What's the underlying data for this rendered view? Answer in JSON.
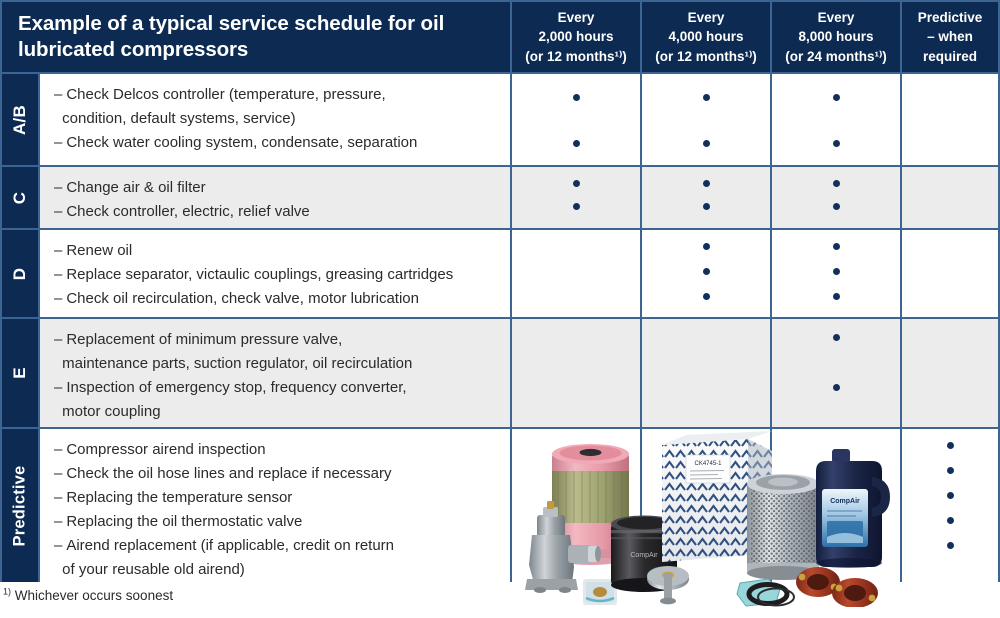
{
  "header": {
    "title": "Example of a typical service schedule for oil lubricated compressors",
    "columns": [
      {
        "id": "every-2000",
        "lines": [
          "Every",
          "2,000 hours",
          "(or 12 months¹⁾)"
        ]
      },
      {
        "id": "every-4000",
        "lines": [
          "Every",
          "4,000 hours",
          "(or 12 months¹⁾)"
        ]
      },
      {
        "id": "every-8000",
        "lines": [
          "Every",
          "8,000 hours",
          "(or 24 months¹⁾)"
        ]
      },
      {
        "id": "predictive",
        "lines": [
          "Predictive",
          "– when",
          "required"
        ]
      }
    ]
  },
  "rows": [
    {
      "id": "ab",
      "label": "A/B",
      "shade": "white",
      "tasks": [
        {
          "text": "Check Delcos controller (temperature, pressure,",
          "cont": "condition, default  systems, service)"
        },
        {
          "text": "Check water cooling system, condensate, separation"
        }
      ],
      "marks": {
        "every-2000": 2,
        "every-4000": 2,
        "every-8000": 2,
        "predictive": 0
      }
    },
    {
      "id": "c",
      "label": "C",
      "shade": "gray",
      "tasks": [
        {
          "text": "Change air & oil filter"
        },
        {
          "text": "Check controller, electric, relief valve"
        }
      ],
      "marks": {
        "every-2000": 2,
        "every-4000": 2,
        "every-8000": 2,
        "predictive": 0
      }
    },
    {
      "id": "d",
      "label": "D",
      "shade": "white",
      "tasks": [
        {
          "text": "Renew oil"
        },
        {
          "text": "Replace separator, victaulic couplings, greasing cartridges"
        },
        {
          "text": "Check oil recirculation, check valve, motor lubrication"
        }
      ],
      "marks": {
        "every-2000": 0,
        "every-4000": 3,
        "every-8000": 3,
        "predictive": 0
      }
    },
    {
      "id": "e",
      "label": "E",
      "shade": "gray",
      "tasks": [
        {
          "text": "Replacement of minimum pressure valve,",
          "cont": "maintenance parts, suction regulator, oil recirculation"
        },
        {
          "text": "Inspection of emergency stop, frequency converter,",
          "cont": "motor coupling"
        }
      ],
      "marks": {
        "every-2000": 0,
        "every-4000": 0,
        "every-8000": 2,
        "predictive": 0
      }
    },
    {
      "id": "predictive",
      "label": "Predictive",
      "shade": "white",
      "tasks": [
        {
          "text": "Compressor airend inspection"
        },
        {
          "text": "Check the oil hose lines and replace if necessary"
        },
        {
          "text": "Replacing the temperature sensor"
        },
        {
          "text": "Replacing the oil thermostatic valve"
        },
        {
          "text": "Airend replacement (if applicable, credit on return",
          "cont": "of your reusable old airend)"
        }
      ],
      "marks": {
        "every-2000": 0,
        "every-4000": 0,
        "every-8000": 0,
        "predictive": 5
      }
    }
  ],
  "footnote": {
    "marker": "1)",
    "text": " Whichever occurs soonest"
  },
  "images": {
    "caption": "Product photo collage of compressor service parts",
    "items": [
      "pressure-relief-valve",
      "air-filter-element",
      "small-gasket-kit",
      "black-oil-filter",
      "mushroom-valve",
      "spare-parts-box",
      "oil-separator-element",
      "seal-gasket-set",
      "compressor-oil-bottle",
      "red-victaulic-couplings"
    ],
    "box_label": "CK4745-1"
  },
  "colors": {
    "navy": "#0d2b52",
    "border_blue": "#3d6593",
    "row_gray": "#ececec",
    "row_white": "#ffffff",
    "dot": "#13305c",
    "text": "#2b2b2b"
  }
}
